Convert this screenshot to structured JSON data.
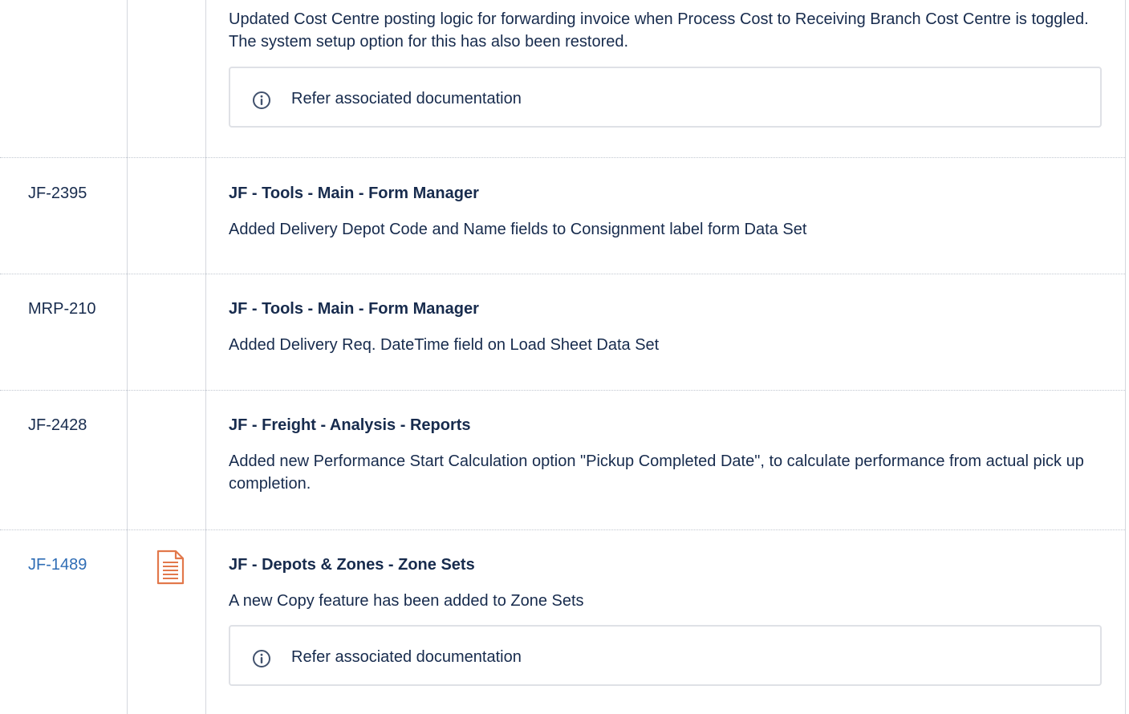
{
  "colors": {
    "link": "#2f6db5",
    "border": "#dfe1e6",
    "text": "#172b4d",
    "doc_icon": "#e2784b"
  },
  "rows": [
    {
      "id": "",
      "has_doc_icon": false,
      "title": "",
      "text": "Updated Cost Centre posting logic for forwarding invoice when Process Cost to Receiving Branch Cost Centre is toggled.   The system setup option for this has also been restored.",
      "note": "Refer associated documentation"
    },
    {
      "id": "JF-2395",
      "has_doc_icon": false,
      "title": "JF - Tools - Main - Form Manager",
      "text": "Added Delivery Depot Code and Name fields to Consignment label form Data Set"
    },
    {
      "id": "MRP-210",
      "has_doc_icon": false,
      "title": "JF - Tools - Main - Form Manager",
      "text": "Added Delivery Req. DateTime field on Load Sheet Data Set"
    },
    {
      "id": "JF-2428",
      "has_doc_icon": false,
      "title": "JF - Freight - Analysis - Reports",
      "text": "Added new Performance Start Calculation option \"Pickup Completed Date\", to calculate performance from actual pick up completion."
    },
    {
      "id": "JF-1489",
      "id_is_link": true,
      "has_doc_icon": true,
      "doc_icon_name": "document-icon",
      "title": "JF - Depots & Zones - Zone Sets",
      "text": "A new Copy feature has been added to Zone Sets",
      "note": "Refer associated documentation"
    }
  ],
  "icons": {
    "info": "info-icon",
    "document": "document-icon"
  }
}
